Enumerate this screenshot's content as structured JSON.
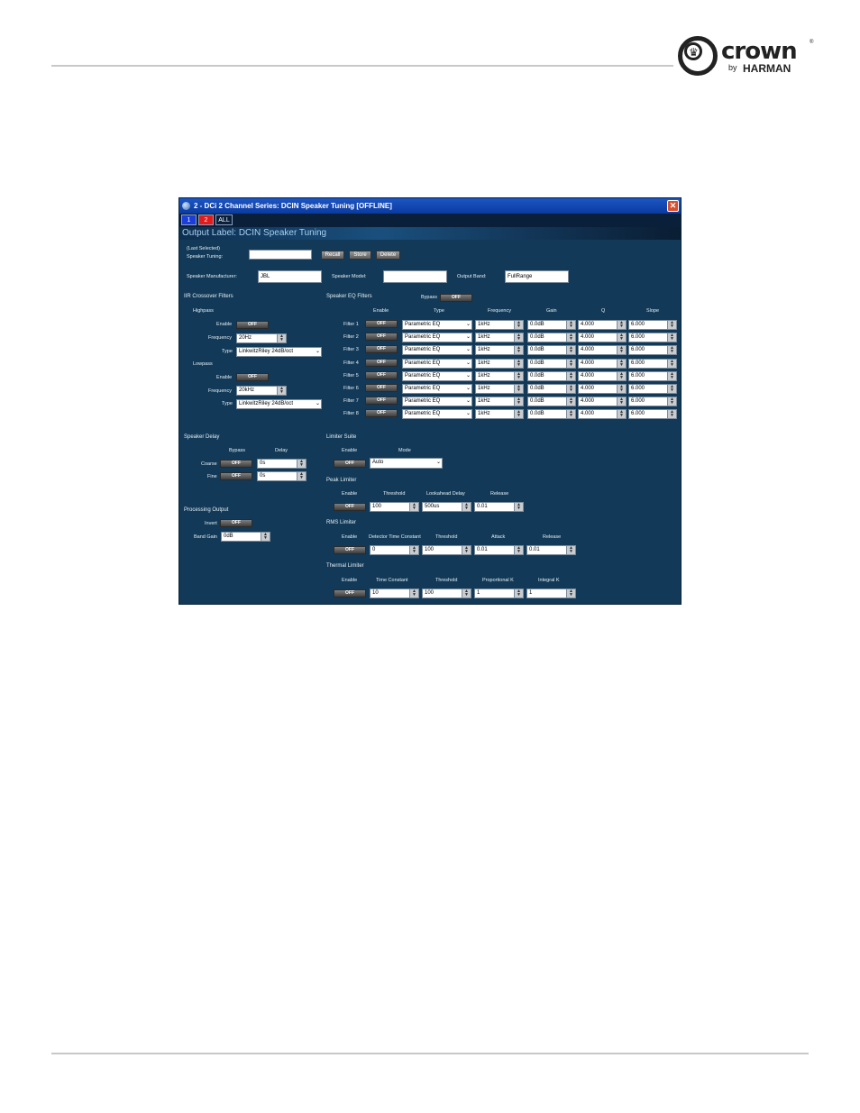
{
  "brand": {
    "word": "crown",
    "reg": "®",
    "by": "by",
    "harman": "HARMAN"
  },
  "window": {
    "title": "2 - DCi 2 Channel Series: DCIN Speaker Tuning [OFFLINE]",
    "close": "✕",
    "channels": [
      "1",
      "2",
      "ALL"
    ],
    "output_label": "Output Label: DCIN Speaker Tuning"
  },
  "tuning": {
    "last_selected": "(Last Selected)",
    "speaker_tuning": "Speaker Tuning:",
    "recall": "Recall",
    "store": "Store",
    "delete": "Delete",
    "manufacturer_label": "Speaker Manufacturer:",
    "manufacturer_value": "JBL",
    "model_label": "Speaker Model:",
    "model_value": "",
    "band_label": "Output Band:",
    "band_value": "FullRange"
  },
  "iir": {
    "title": "IIR Crossover Filters",
    "highpass": "Highpass",
    "lowpass": "Lowpass",
    "enable": "Enable",
    "frequency": "Frequency",
    "type": "Type",
    "off": "OFF",
    "hp_freq": "20Hz",
    "hp_type": "LinkwitzRiley 24dB/oct",
    "lp_freq": "20kHz",
    "lp_type": "LinkwitzRiley 24dB/oct"
  },
  "eq": {
    "title": "Speaker EQ Filters",
    "bypass": "Bypass",
    "headers": {
      "enable": "Enable",
      "type": "Type",
      "frequency": "Frequency",
      "gain": "Gain",
      "q": "Q",
      "slope": "Slope"
    },
    "filters": [
      {
        "label": "Filter 1",
        "enable": "OFF",
        "type": "Parametric EQ",
        "freq": "1kHz",
        "gain": "0.0dB",
        "q": "4.000",
        "slope": "6.000"
      },
      {
        "label": "Filter 2",
        "enable": "OFF",
        "type": "Parametric EQ",
        "freq": "1kHz",
        "gain": "0.0dB",
        "q": "4.000",
        "slope": "6.000"
      },
      {
        "label": "Filter 3",
        "enable": "OFF",
        "type": "Parametric EQ",
        "freq": "1kHz",
        "gain": "0.0dB",
        "q": "4.000",
        "slope": "6.000"
      },
      {
        "label": "Filter 4",
        "enable": "OFF",
        "type": "Parametric EQ",
        "freq": "1kHz",
        "gain": "0.0dB",
        "q": "4.000",
        "slope": "6.000"
      },
      {
        "label": "Filter 5",
        "enable": "OFF",
        "type": "Parametric EQ",
        "freq": "1kHz",
        "gain": "0.0dB",
        "q": "4.000",
        "slope": "6.000"
      },
      {
        "label": "Filter 6",
        "enable": "OFF",
        "type": "Parametric EQ",
        "freq": "1kHz",
        "gain": "0.0dB",
        "q": "4.000",
        "slope": "6.000"
      },
      {
        "label": "Filter 7",
        "enable": "OFF",
        "type": "Parametric EQ",
        "freq": "1kHz",
        "gain": "0.0dB",
        "q": "4.000",
        "slope": "6.000"
      },
      {
        "label": "Filter 8",
        "enable": "OFF",
        "type": "Parametric EQ",
        "freq": "1kHz",
        "gain": "0.0dB",
        "q": "4.000",
        "slope": "6.000"
      }
    ]
  },
  "delay": {
    "title": "Speaker Delay",
    "bypass": "Bypass",
    "delay": "Delay",
    "coarse": "Coarse",
    "fine": "Fine",
    "coarse_value": "0s",
    "fine_value": "0s"
  },
  "processing": {
    "title": "Processing Output",
    "invert": "Invert",
    "band_gain": "Band Gain",
    "band_gain_value": "0dB"
  },
  "limiter": {
    "title": "Limiter Suite",
    "enable": "Enable",
    "mode": "Mode",
    "mode_value": "Auto",
    "peak": {
      "title": "Peak Limiter",
      "threshold": "Threshold",
      "lookahead": "Lookahead Delay",
      "release": "Release",
      "threshold_value": "100",
      "lookahead_value": "500us",
      "release_value": "0.01"
    },
    "rms": {
      "title": "RMS Limiter",
      "detector": "Detector Time Constant",
      "threshold": "Threshold",
      "attack": "Attack",
      "release": "Release",
      "detector_value": "0",
      "threshold_value": "100",
      "attack_value": "0.01",
      "release_value": "0.01"
    },
    "thermal": {
      "title": "Thermal Limiter",
      "time_constant": "Time Constant",
      "threshold": "Threshold",
      "proportional": "Proportional K",
      "integral": "Integral K",
      "time_constant_value": "10",
      "threshold_value": "100",
      "proportional_value": "1",
      "integral_value": "1"
    }
  }
}
